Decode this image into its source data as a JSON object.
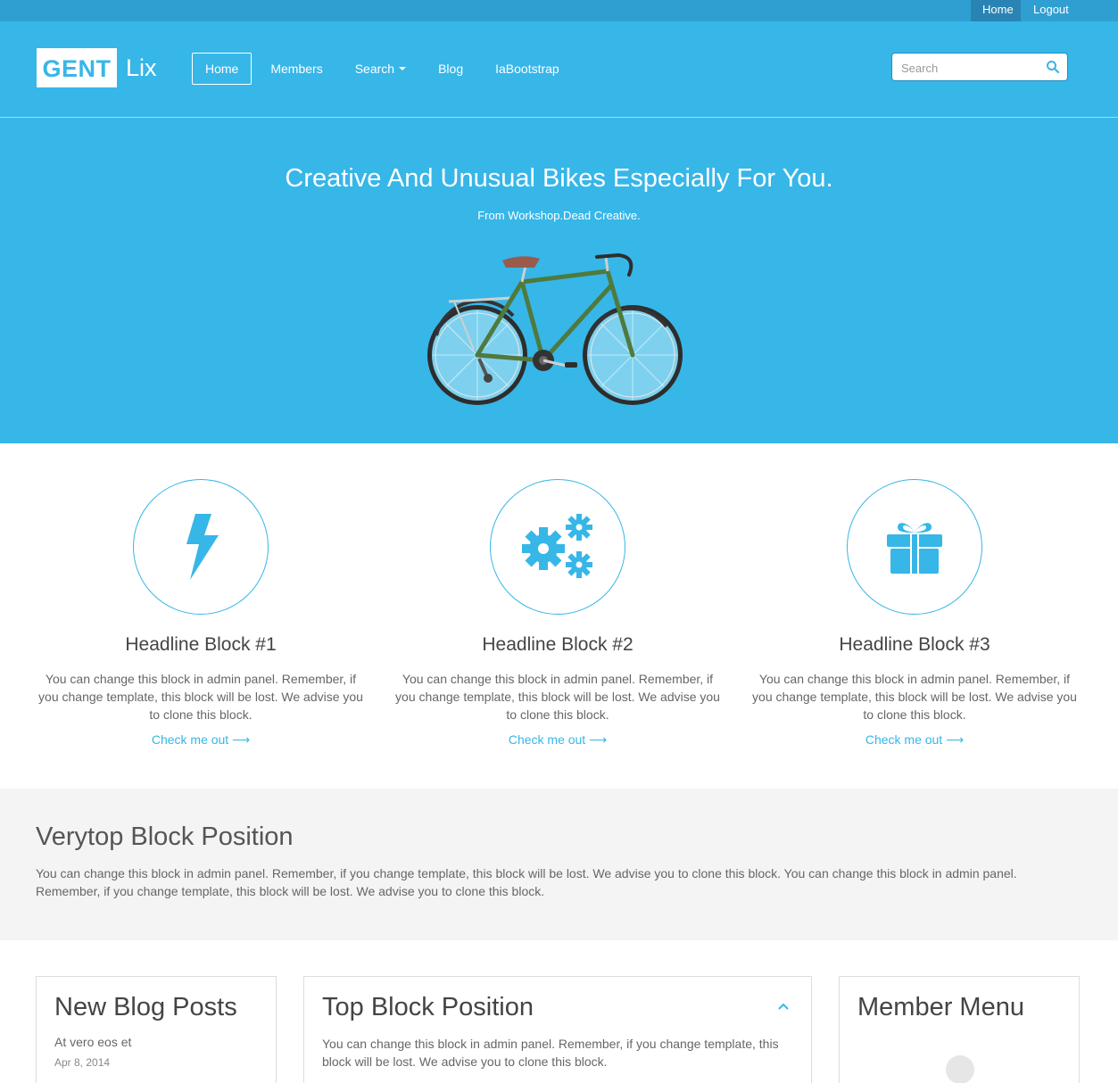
{
  "topbar": {
    "home": "Home",
    "logout": "Logout"
  },
  "header": {
    "logo_main": "GENT",
    "logo_rest": "Lix",
    "nav": [
      {
        "label": "Home",
        "active": true
      },
      {
        "label": "Members"
      },
      {
        "label": "Search",
        "dropdown": true
      },
      {
        "label": "Blog"
      },
      {
        "label": "IaBootstrap"
      }
    ],
    "search_placeholder": "Search"
  },
  "hero": {
    "title": "Creative And Unusual Bikes Especially For You.",
    "subtitle": "From Workshop.Dead Creative."
  },
  "features": [
    {
      "icon": "lightning-icon",
      "title": "Headline Block #1",
      "text": "You can change this block in admin panel. Remember, if you change template, this block will be lost. We advise you to clone this block.",
      "link": "Check me out"
    },
    {
      "icon": "gears-icon",
      "title": "Headline Block #2",
      "text": "You can change this block in admin panel. Remember, if you change template, this block will be lost. We advise you to clone this block.",
      "link": "Check me out"
    },
    {
      "icon": "gift-icon",
      "title": "Headline Block #3",
      "text": "You can change this block in admin panel. Remember, if you change template, this block will be lost. We advise you to clone this block.",
      "link": "Check me out"
    }
  ],
  "verytop": {
    "title": "Verytop Block Position",
    "text": "You can change this block in admin panel. Remember, if you change template, this block will be lost. We advise you to clone this block. You can change this block in admin panel. Remember, if you change template, this block will be lost. We advise you to clone this block."
  },
  "blog": {
    "title": "New Blog Posts",
    "posts": [
      {
        "title": "At vero eos et",
        "date": "Apr 8, 2014"
      }
    ]
  },
  "topblock": {
    "title": "Top Block Position",
    "text": "You can change this block in admin panel. Remember, if you change template, this block will be lost. We advise you to clone this block."
  },
  "member_menu": {
    "title": "Member Menu"
  },
  "colors": {
    "primary": "#37b6e8",
    "topbar": "#2f9fd2",
    "topbar_active": "#2a84b3",
    "panel_bg": "#f4f4f4"
  }
}
